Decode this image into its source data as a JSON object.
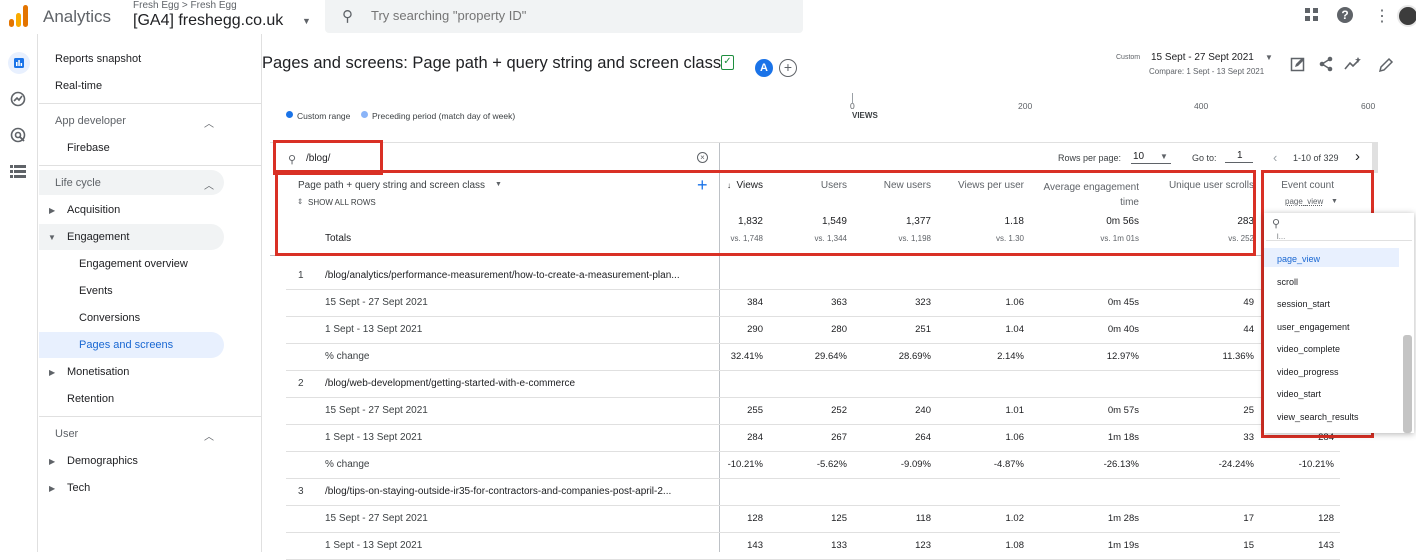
{
  "topbar": {
    "app_name": "Analytics",
    "breadcrumb": "Fresh Egg > Fresh Egg",
    "property": "[GA4] freshegg.co.uk",
    "search_placeholder": "Try searching \"property ID\""
  },
  "sidebar": {
    "reports_snapshot": "Reports snapshot",
    "realtime": "Real-time",
    "app_developer": "App developer",
    "firebase": "Firebase",
    "life_cycle": "Life cycle",
    "acquisition": "Acquisition",
    "engagement": "Engagement",
    "engagement_overview": "Engagement overview",
    "events": "Events",
    "conversions": "Conversions",
    "pages_and_screens": "Pages and screens",
    "monetisation": "Monetisation",
    "retention": "Retention",
    "user": "User",
    "demographics": "Demographics",
    "tech": "Tech"
  },
  "header": {
    "title": "Pages and screens: Page path + query string and screen class",
    "avatar": "A",
    "date_label": "Custom",
    "date_range": "15 Sept - 27 Sept 2021",
    "compare": "Compare: 1 Sept - 13 Sept 2021"
  },
  "chart": {
    "legend_current": "Custom range",
    "legend_previous": "Preceding period (match day of week)",
    "ticks": [
      "0",
      "200",
      "400",
      "600"
    ],
    "axis_label": "VIEWS",
    "colors": {
      "current": "#1a73e8",
      "previous": "#8ab4f8"
    }
  },
  "table": {
    "filter_value": "/blog/",
    "rows_per_page_label": "Rows per page:",
    "rows_per_page": "10",
    "go_to_label": "Go to:",
    "go_to": "1",
    "pagination": "1-10 of 329",
    "dimension_header": "Page path + query string and screen class",
    "show_all_rows": "SHOW ALL ROWS",
    "totals_label": "Totals",
    "metric_headers": [
      "Views",
      "Users",
      "New users",
      "Views per user",
      "Average engagement time",
      "Unique user scrolls",
      "Event count"
    ],
    "event_count_filter": "page_view",
    "totals": [
      "1,832",
      "1,549",
      "1,377",
      "1.18",
      "0m 56s",
      "283"
    ],
    "totals_prev": [
      "vs. 1,748",
      "vs. 1,344",
      "vs. 1,198",
      "vs. 1.30",
      "vs. 1m 01s",
      "vs. 252"
    ],
    "rows": [
      {
        "index": "1",
        "path": "/blog/analytics/performance-measurement/how-to-create-a-measurement-plan...",
        "sub": [
          {
            "label": "15 Sept - 27 Sept 2021",
            "values": [
              "384",
              "363",
              "323",
              "1.06",
              "0m 45s",
              "49",
              ""
            ]
          },
          {
            "label": "1 Sept - 13 Sept 2021",
            "values": [
              "290",
              "280",
              "251",
              "1.04",
              "0m 40s",
              "44",
              ""
            ]
          },
          {
            "label": "% change",
            "values": [
              "32.41%",
              "29.64%",
              "28.69%",
              "2.14%",
              "12.97%",
              "11.36%",
              ""
            ]
          }
        ]
      },
      {
        "index": "2",
        "path": "/blog/web-development/getting-started-with-e-commerce",
        "sub": [
          {
            "label": "15 Sept - 27 Sept 2021",
            "values": [
              "255",
              "252",
              "240",
              "1.01",
              "0m 57s",
              "25",
              ""
            ]
          },
          {
            "label": "1 Sept - 13 Sept 2021",
            "values": [
              "284",
              "267",
              "264",
              "1.06",
              "1m 18s",
              "33",
              "284"
            ]
          },
          {
            "label": "% change",
            "values": [
              "-10.21%",
              "-5.62%",
              "-9.09%",
              "-4.87%",
              "-26.13%",
              "-24.24%",
              "-10.21%"
            ]
          }
        ]
      },
      {
        "index": "3",
        "path": "/blog/tips-on-staying-outside-ir35-for-contractors-and-companies-post-april-2...",
        "sub": [
          {
            "label": "15 Sept - 27 Sept 2021",
            "values": [
              "128",
              "125",
              "118",
              "1.02",
              "1m 28s",
              "17",
              "128"
            ]
          },
          {
            "label": "1 Sept - 13 Sept 2021",
            "values": [
              "143",
              "133",
              "123",
              "1.08",
              "1m 19s",
              "15",
              "143"
            ]
          }
        ]
      }
    ]
  },
  "event_dropdown": {
    "items": [
      "page_view",
      "scroll",
      "session_start",
      "user_engagement",
      "video_complete",
      "video_progress",
      "video_start",
      "view_search_results"
    ],
    "selected": "page_view"
  }
}
